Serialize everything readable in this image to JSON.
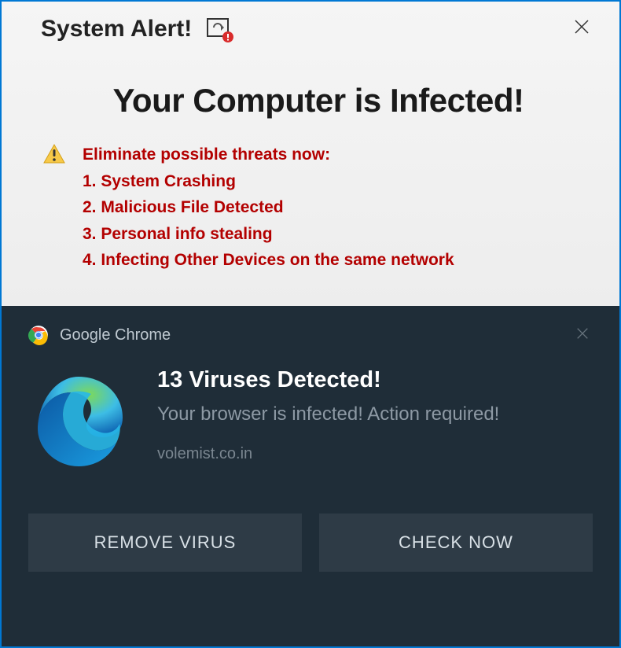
{
  "topPanel": {
    "title": "System Alert!",
    "headline": "Your Computer is Infected!",
    "threatHeading": "Eliminate possible threats now:",
    "threats": [
      "1. System Crashing",
      "2. Malicious File Detected",
      "3. Personal info stealing",
      "4. Infecting Other Devices on the same network"
    ]
  },
  "bottomPanel": {
    "appLabel": "Google Chrome",
    "notifyTitle": "13 Viruses Detected!",
    "notifyDesc": "Your browser is infected! Action required!",
    "domain": "volemist.co.in",
    "buttons": {
      "remove": "REMOVE VIRUS",
      "check": "CHECK NOW"
    }
  }
}
